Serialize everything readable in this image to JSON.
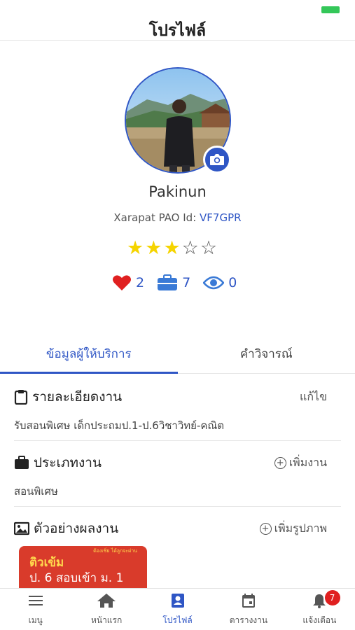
{
  "header": {
    "title": "โปรไฟล์"
  },
  "profile": {
    "name": "Pakinun",
    "pao_label": "Xarapat PAO Id:",
    "pao_id": "VF7GPR",
    "rating": 3,
    "rating_max": 5,
    "stats": {
      "likes": "2",
      "jobs": "7",
      "views": "0"
    }
  },
  "tabs": [
    {
      "label": "ข้อมูลผู้ให้บริการ",
      "active": true
    },
    {
      "label": "คำวิจารณ์",
      "active": false
    }
  ],
  "sections": {
    "job_details": {
      "title": "รายละเอียดงาน",
      "action": "แก้ไข",
      "body": "รับสอนพิเศษ เด็กประถมป.1-ป.6วิชาวิทย์-คณิต"
    },
    "job_type": {
      "title": "ประเภทงาน",
      "action": "เพิ่มงาน",
      "body": "สอนพิเศษ"
    },
    "portfolio": {
      "title": "ตัวอย่างผลงาน",
      "action": "เพิ่มรูปภาพ"
    }
  },
  "sample": {
    "small": "ต้องเชิ่ย ได้ลูกจะผ่าน",
    "line1": "ติวเข้ม",
    "line2": "ป. 6 สอบเข้า ม. 1"
  },
  "colors": {
    "accent": "#2f56c5",
    "star": "#f5d400",
    "heart": "#e02020",
    "badge": "#e02020",
    "battery": "#34c759"
  },
  "tabbar": [
    {
      "label": "เมนู",
      "icon": "menu-icon",
      "active": false
    },
    {
      "label": "หน้าแรก",
      "icon": "home-icon",
      "active": false
    },
    {
      "label": "โปรไฟล์",
      "icon": "profile-icon",
      "active": true
    },
    {
      "label": "ตารางงาน",
      "icon": "calendar-icon",
      "active": false
    },
    {
      "label": "แจ้งเตือน",
      "icon": "bell-icon",
      "active": false,
      "badge": "7"
    }
  ]
}
